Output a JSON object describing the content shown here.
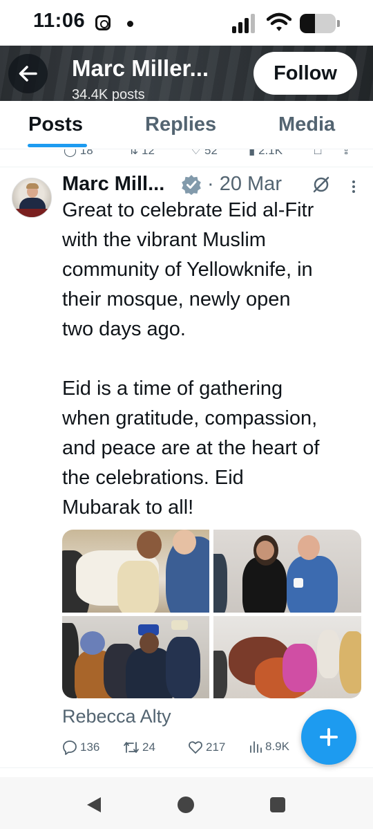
{
  "status_bar": {
    "time": "11:06",
    "icons": [
      "instagram-notification-icon",
      "notification-dot",
      "signal-icon",
      "wifi-icon",
      "battery-icon"
    ],
    "battery_level": 0.42
  },
  "header": {
    "title": "Marc Miller...",
    "subtitle_partial": "34.4K posts",
    "follow_label": "Follow",
    "back_icon": "arrow-left-icon"
  },
  "tabs": [
    {
      "label": "Posts",
      "active": true
    },
    {
      "label": "Replies",
      "active": false
    },
    {
      "label": "Media",
      "active": false
    }
  ],
  "previous_tweet_stats": {
    "replies": "18",
    "reposts": "12",
    "likes": "52",
    "views": "2.1K"
  },
  "tweet": {
    "author": "Marc Mill...",
    "verified": true,
    "date": "· 20 Mar",
    "text": "Great to celebrate Eid al-Fitr\nwith the vibrant Muslim\ncommunity of Yellowknife, in\ntheir mosque, newly open\ntwo days ago.\n\nEid is a time of gathering\nwhen gratitude, compassion,\nand peace are at the heart of\nthe celebrations. Eid\nMubarak to all!",
    "photo_count": 4,
    "caption": "Rebecca Alty",
    "stats": {
      "replies": "136",
      "reposts": "24",
      "likes": "217",
      "views": "8.9K"
    }
  },
  "fab": {
    "icon": "plus-icon"
  },
  "colors": {
    "accent": "#1d9bf0",
    "text_primary": "#0f1419",
    "text_secondary": "#536471",
    "verified": "#829aab"
  }
}
